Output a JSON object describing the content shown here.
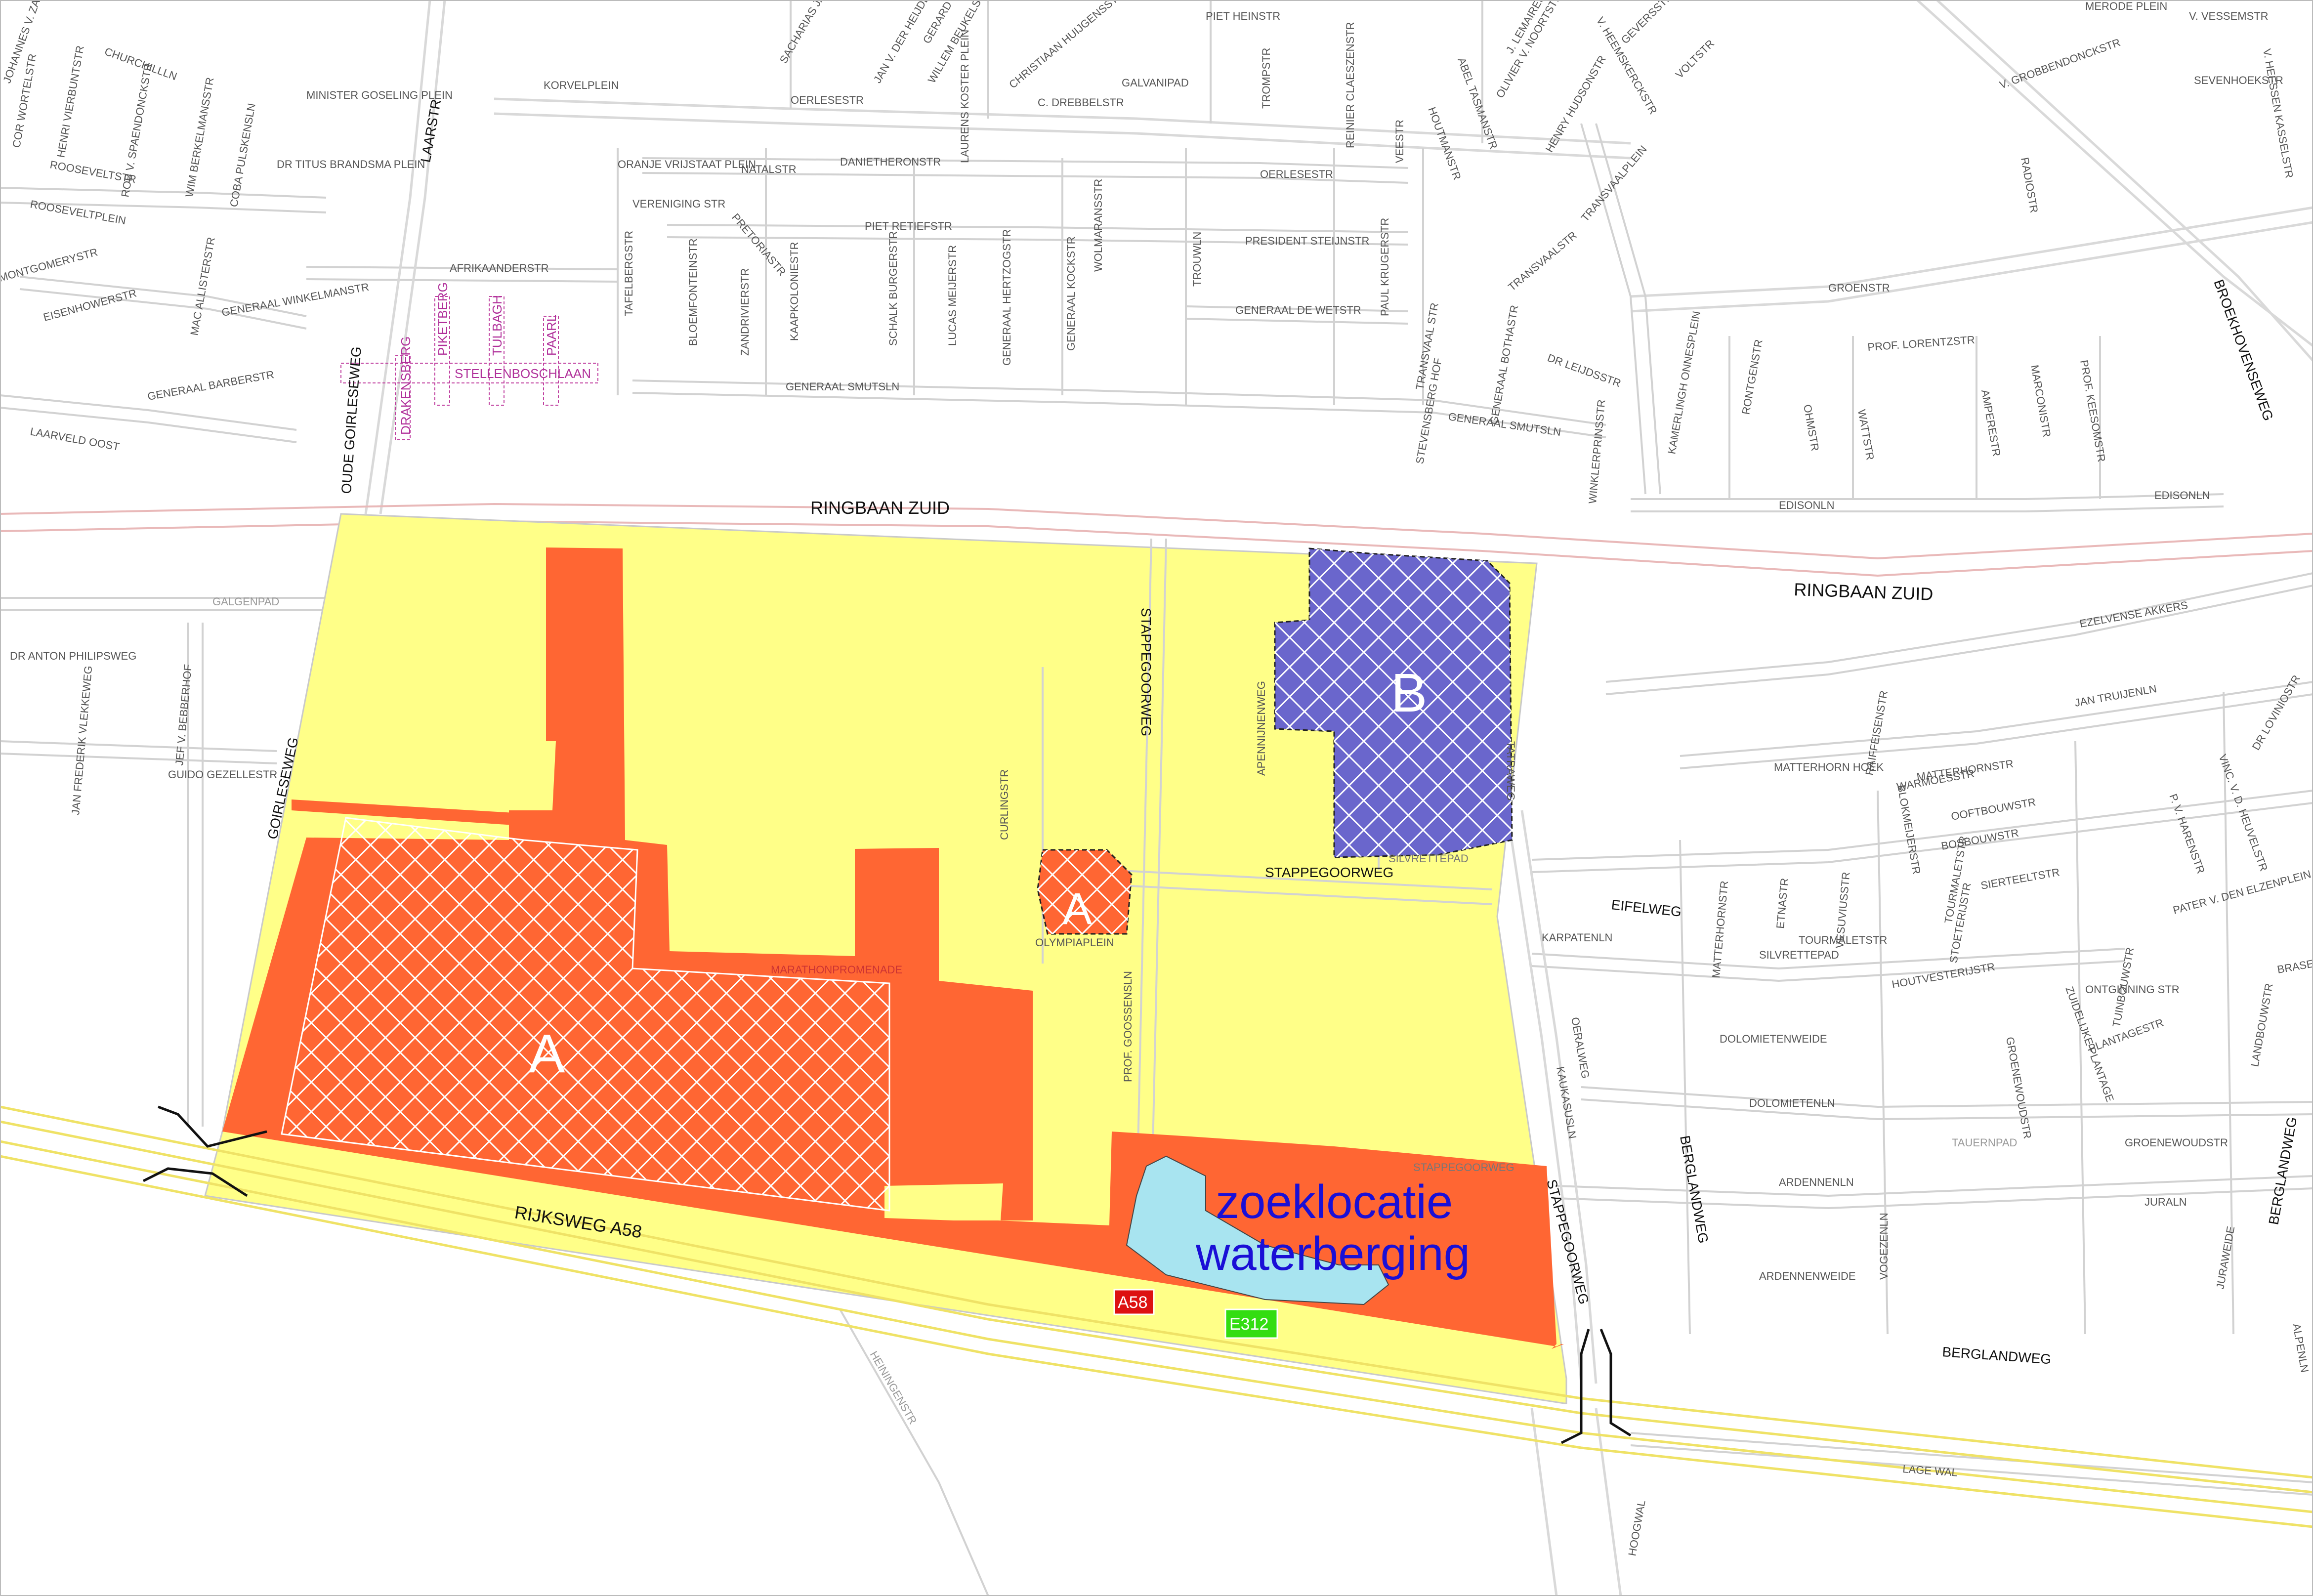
{
  "map": {
    "search_label_line1": "zoeklocatie",
    "search_label_line2": "waterberging",
    "area_a": "A",
    "area_b": "B",
    "colors": {
      "plan_area": "#ffff88",
      "zone_orange": "#ff6633",
      "zone_blue": "#6a66cc",
      "water": "#a8e4f0",
      "search_text": "#1a0fd6",
      "roads": "#d9d9d9",
      "motorway": "#efe266",
      "ring_road": "#e9b9b9"
    },
    "shields": {
      "a58": "A58",
      "e312": "E312"
    },
    "major_labels": {
      "ringbaan_zuid_1": "RINGBAAN ZUID",
      "ringbaan_zuid_2": "RINGBAAN ZUID",
      "rijksweg": "RIJKSWEG  A58",
      "stappegoorweg_v": "STAPPEGOORWEG",
      "stappegoorweg_h": "STAPPEGOORWEG",
      "stappegoorweg_se": "STAPPEGOORWEG",
      "goirleseweg": "GOIRLESEWEG",
      "oude_goirleseweg": "OUDE GOIRLESEWEG",
      "laarstr": "LAARSTR",
      "eifelweg": "EIFELWEG",
      "berglandweg_v": "BERGLANDWEG",
      "berglandweg_h": "BERGLANDWEG",
      "broekhovenseweg": "BROEKHOVENSEWEG",
      "berglandweg_e": "BERGLANDWEG"
    },
    "street_labels": {
      "oerlesestr_1": "OERLESESTR",
      "oerlesestr_2": "OERLESESTR",
      "danietheronstr": "DANIETHERONSTR",
      "piet_retiefstr": "PIET RETIEFSTR",
      "president_steijnstr": "PRESIDENT STEIJNSTR",
      "generaal_de_wetstr": "GENERAAL DE WETSTR",
      "afrikaanderstr": "AFRIKAANDERSTR",
      "generaal_winkelmanstr": "GENERAAL WINKELMANSTR",
      "generaal_smutsln_1": "GENERAAL SMUTSLN",
      "generaal_smutsln_2": "GENERAAL SMUTSLN",
      "stellenboschlaan": "STELLENBOSCHLAAN",
      "groenstr": "GROENSTR",
      "prof_lorentzstr": "PROF. LORENTZSTR",
      "edisonln_1": "EDISONLN",
      "edisonln_2": "EDISONLN",
      "ezelvense_akkers": "EZELVENSE AKKERS",
      "jan_truijenln": "JAN TRUIJENLN",
      "matterhornstr": "MATTERHORNSTR",
      "matterhorn_hoek": "MATTERHORN HOEK",
      "karpatenln": "KARPATENLN",
      "tourmaletstr": "TOURMALETSTR",
      "silvrettepad": "SILVRETTEPAD",
      "dolomietenweide": "DOLOMIETENWEIDE",
      "dolomietenln": "DOLOMIETENLN",
      "tauernpad": "TAUERNPAD",
      "groenewoudstr": "GROENEWOUDSTR",
      "ardennenln": "ARDENNENLN",
      "ardennenweide": "ARDENNENWEIDE",
      "juraln": "JURALN",
      "lage_wal": "LAGE WAL",
      "hoogwal": "HOOGWAL",
      "heiningenstr": "HEININGENSTR",
      "galgenpad": "GALGENPAD",
      "dr_anton_philipsweg": "DR ANTON PHILIPSWEG",
      "jan_frederik_vlekkeweg": "JAN FREDERIK VLEKKEWEG",
      "jef_v_bebberhof": "JEF V. BEBBERHOF",
      "guido_gezellestr": "GUIDO GEZELLESTR",
      "curlingstr": "CURLINGSTR",
      "olympiaplein": "OLYMPIAPLEIN",
      "prof_goossensln": "PROF. GOOSSENSLN",
      "marathonpromenade": "MARATHONPROMENADE",
      "apennijnenweg": "APENNIJNENWEG",
      "tatraweg": "TATRAWEG",
      "silvrettepad_2": "SILVRETTEPAD",
      "stappegoorweg_small": "STAPPEGOORWEG",
      "laarveld_oost": "LAARVELD OOST",
      "generaal_barberstr": "GENERAAL BARBERSTR",
      "mac_allisterstr": "MAC ALLISTERSTR",
      "eisenhowerstr": "EISENHOWERSTR",
      "montgomerystr": "MONTGOMERYSTR",
      "rooseveltplein": "ROOSEVELTPLEIN",
      "rooseveltstr": "ROOSEVELTSTR",
      "korvelplein": "KORVELPLEIN",
      "piet_heinstr": "PIET HEINSTR",
      "tromstr": "TROMPSTR",
      "reinier_claeszenstr": "REINIER CLAESZENSTR",
      "houtmanstr": "HOUTMANSTR",
      "abel_tasmanstr": "ABEL TASMANSTR",
      "henry_hudsonstr": "HENRY HUDSONSTR",
      "transvaalplein": "TRANSVAALPLEIN",
      "transvaalstr": "TRANSVAALSTR",
      "voltstr": "VOLTSTR",
      "sevenhoekstr": "SEVENHOEKSTR",
      "radiostr": "RADIOSTR",
      "ampereSTR": "AMPERESTR",
      "marconistr": "MARCONISTR",
      "wattstr": "WATTSTR",
      "ohmstr": "OHMSTR",
      "rontgenstr": "RONTGENSTR",
      "kamerlingh_onnesplein": "KAMERLINGH ONNESPLEIN",
      "winklerprinsstr": "WINKLERPRINSSTR",
      "dr_leijdsstr": "DR LEIJDSSTR",
      "paul_krugerstr": "PAUL KRUGERSTR",
      "galvanipad": "GALVANIPAD",
      "c_drebbelstr": "C. DREBBELSTR",
      "christiaan_huijgensstr": "CHRISTIAAN HUIJGENSSTR",
      "natalstr": "NATALSTR",
      "pretoriastr": "PRETORIASTR",
      "bloemfonteinstr": "BLOEMFONTEINSTR",
      "tafelbergstr": "TAFELBERGSTR",
      "zandrivierstr": "ZANDRIVIERSTR",
      "kaapkolonistr": "KAAPKOLONIESTR",
      "schalk_burgerstr": "SCHALK BURGERSTR",
      "lucas_meijerstr": "LUCAS MEIJERSTR",
      "generaal_hertzogstr": "GENERAAL HERTZOGSTR",
      "generaal_kockstr": "GENERAAL KOCKSTR",
      "wolmaransstr": "WOLMARANSSTR",
      "trouwln": "TROUWLN",
      "drakensberg": "DRAKENSBERG",
      "piketberg": "PIKETBERG",
      "tulbagh": "TULBAGH",
      "paarl": "PAARL",
      "vogezenln": "VOGEZENLN",
      "kaukasusln": "KAUKASUSLN",
      "oeralweg": "OERALWEG",
      "juraweide": "JURAWEIDE",
      "alpenln": "ALPENLN",
      "henrivierbuntstr": "HENRI VIERBUNTSTR",
      "cor_wortelstr": "COR WORTELSTR",
      "rob_v_spaendonckstr": "ROB V. SPAENDONCKSTR",
      "wim_berkelmansstr": "WIM BERKELMANSSTR",
      "coba_pulskensln": "COBA PULSKENSLN",
      "minister_goseling_plein": "MINISTER GOSELING PLEIN",
      "dr_titus_brandsma_plein": "DR TITUS BRANDSMA PLEIN",
      "oranje_vrijstaat_plein": "ORANJE VRIJSTAAT PLEIN",
      "vereniging_str": "VERENIGING STR",
      "laurens_koster_plein": "LAURENS KOSTER PLEIN",
      "stevensberg_hof": "STEVENSBERG HOF",
      "generaal_bothastr": "GENERAAL BOTHASTR",
      "transvaal_str": "TRANSVAAL STR",
      "prof_keesomstr": "PROF. KEESOMSTR",
      "grobbendonckstr": "V. GROBBENDONCKSTR",
      "broekhovenseweg_label": "BROEKHOVENSEWEG",
      "verheijden": "V. HEESSEN KASSELSTR",
      "vessemstr": "V. VESSEMSTR",
      "merode_plein": "MERODE PLEIN",
      "willem_beukelsstr": "WILLEM BEUKELSSTR",
      "jan_v_der_heijdenstr": "JAN V. DER HEIJDENSTR",
      "gerard_mercatorstr": "GERARD MERCATORSTR",
      "jansenstr": "SACHARIAS JANSENSTR",
      "churchilllaan": "CHURCHILLLN",
      "johannes_v_zantenstr": "JOHANNES V. ZANTENSTR",
      "olivier_v_noortstr": "OLIVIER V. NOORTSTR",
      "j_lemairestr": "J. LEMAIRESTR",
      "veestr": "VEESTR",
      "geversstr": "GEVERSSTR",
      "heemskerckstr": "V. HEEMSKERCKSTR",
      "raiffeisenstr": "RAIFFEISENSTR",
      "blokmeijerstr": "BLOKMEIJERSTR",
      "warmoesstr": "WARMOESSTR",
      "bosbouwstr": "BOSBOUWSTR",
      "ooftbouwstr": "OOFTBOUWSTR",
      "sierteeltstr": "SIERTEELTSTR",
      "stoeterijstr": "STOETERIJSTR",
      "houtvesterijstr": "HOUTVESTERIJSTR",
      "tuinbouwstr": "TUINBOUWSTR",
      "plantagestr": "PLANTAGESTR",
      "groenewoudstr_v": "GROENEWOUDSTR",
      "landbouwstr": "LANDBOUWSTR",
      "pater_v_den_elzenplein": "PATER V. DEN ELZENPLEIN",
      "p_v_harenstr": "P. V. HARENSTR",
      "dr_loviniostr": "DR LOVINIOSTR",
      "vinc_v_d_heuvelstr": "VINC. V. D. HEUVELSTR",
      "etnastr": "ETNASTR",
      "vesuviusstr": "VESUVIUSSTR",
      "tourmaletstr_v": "TOURMALETSTR",
      "matterhornstr_v": "MATTERHORNSTR",
      "brasem": "BRASEMSTR",
      "zuidelijke_plantage": "ZUIDELIJKE PLANTAGE",
      "ontginning_str": "ONTGINNING STR"
    }
  }
}
